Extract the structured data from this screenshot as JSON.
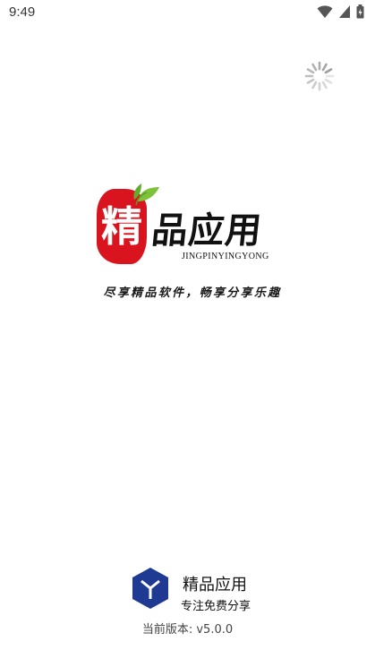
{
  "status_bar": {
    "time": "9:49",
    "icons": [
      "wifi-icon",
      "signal-icon",
      "battery-icon"
    ]
  },
  "splash": {
    "loading_indicator": "spinner-icon",
    "logo": {
      "seal_char": "精",
      "title_chars": "品应用",
      "pinyin": "JINGPINYINGYONG"
    },
    "slogan": "尽享精品软件，畅享分享乐趣"
  },
  "footer": {
    "app_name": "精品应用",
    "tagline": "专注免费分享",
    "version_label": "当前版本: ",
    "version_value": "v5.0.0"
  },
  "colors": {
    "seal_red": "#d9141e",
    "leaf_green": "#7cc23b",
    "brand_icon_blue": "#1f3a93"
  }
}
